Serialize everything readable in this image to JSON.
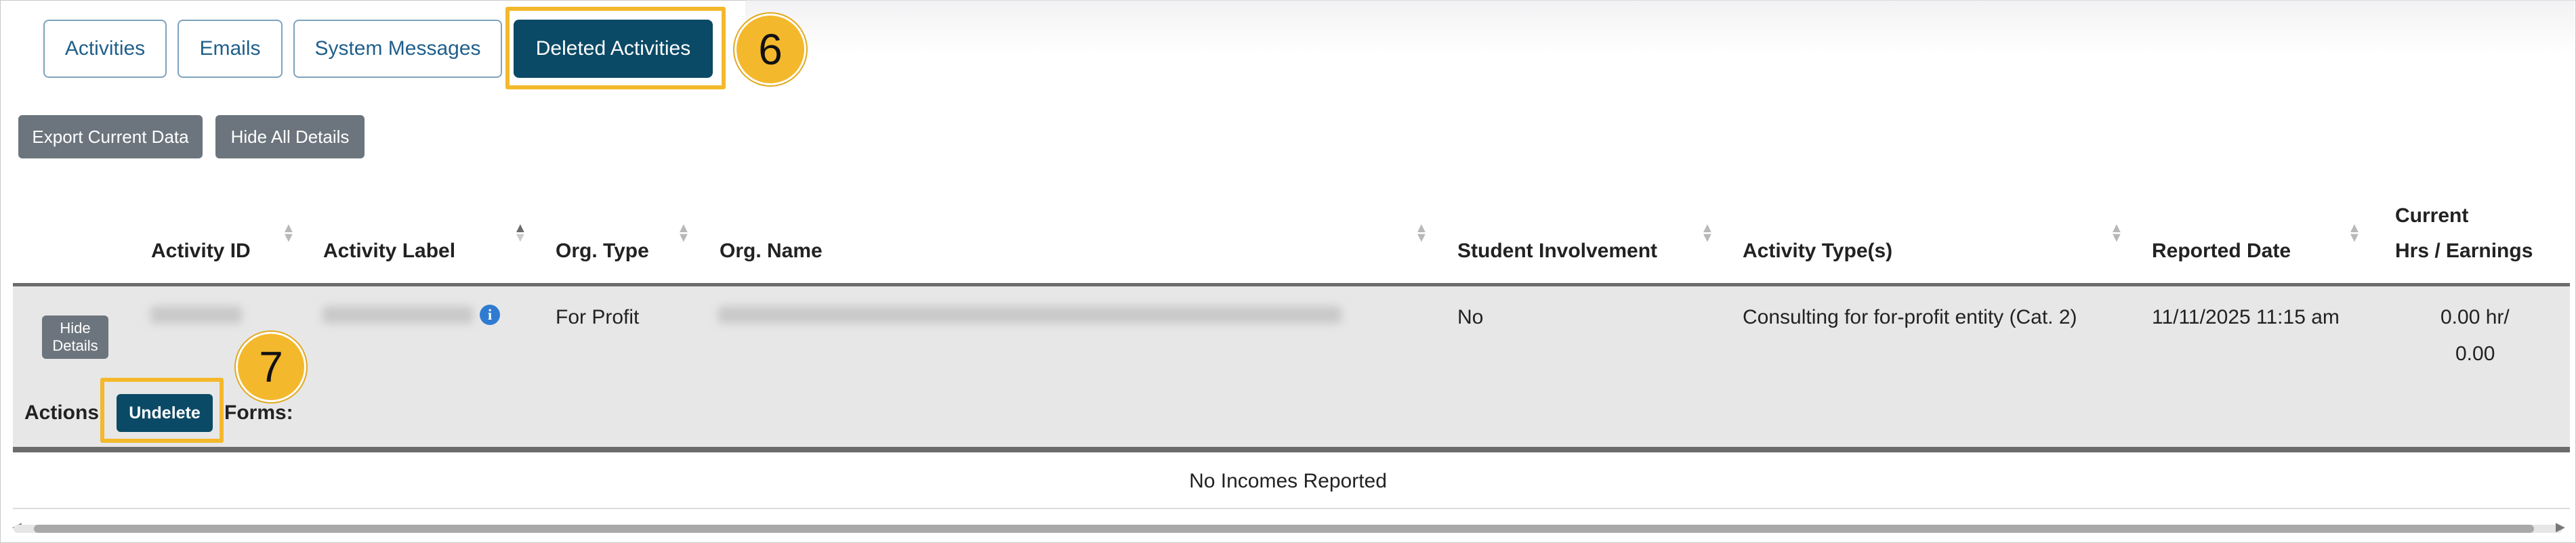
{
  "tabs": [
    {
      "label": "Activities"
    },
    {
      "label": "Emails"
    },
    {
      "label": "System Messages"
    },
    {
      "label": "Deleted Activities"
    }
  ],
  "callouts": [
    "6",
    "7"
  ],
  "toolbar": {
    "export_label": "Export Current Data",
    "hide_all_label": "Hide All Details"
  },
  "table": {
    "headers": {
      "activity_id": "Activity ID",
      "activity_label": "Activity Label",
      "org_type": "Org. Type",
      "org_name": "Org. Name",
      "student_involvement": "Student Involvement",
      "activity_types": "Activity Type(s)",
      "reported_date": "Reported Date",
      "current_line1": "Current",
      "current_line2": "Hrs / Earnings"
    },
    "row": {
      "hide_details_line1": "Hide",
      "hide_details_line2": "Details",
      "org_type": "For Profit",
      "student_involvement": "No",
      "activity_types": "Consulting for for-profit entity (Cat. 2)",
      "reported_date": "11/11/2025 11:15 am",
      "hours_line1": "0.00 hr/",
      "hours_line2": "0.00",
      "actions_label": "Actions",
      "undelete_label": "Undelete",
      "forms_label": "Forms:"
    },
    "empty_message": "No Incomes Reported"
  },
  "colors": {
    "accent": "#0b4a66",
    "highlight": "#f4b82c",
    "gray_button": "#6c757d",
    "info_icon": "#2f7bd1"
  },
  "icons": {
    "info": "info-icon",
    "sort": "sort-icon"
  }
}
